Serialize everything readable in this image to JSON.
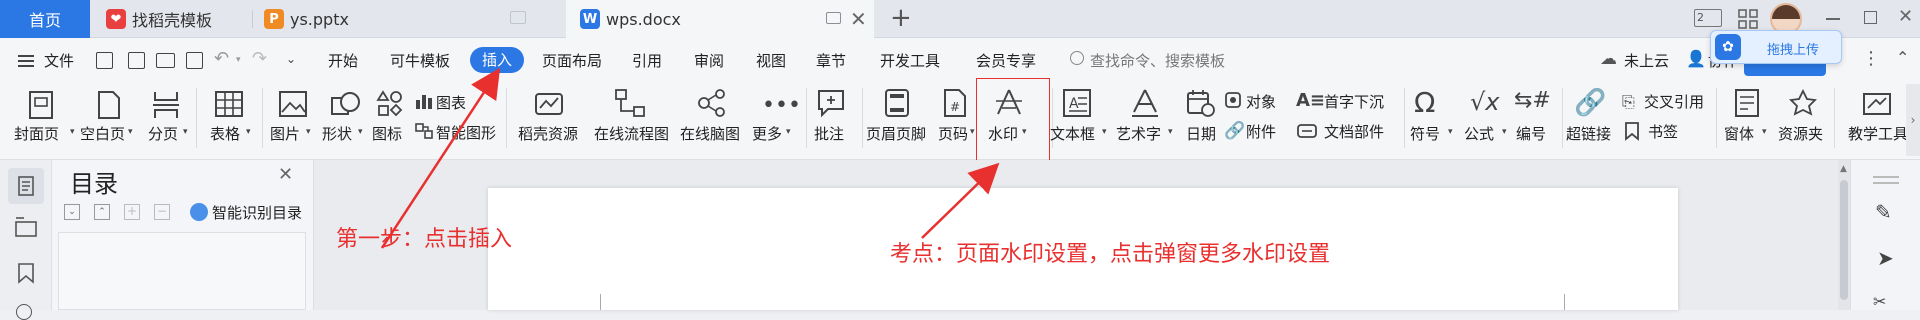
{
  "tabs": [
    {
      "label": "首页",
      "active": false,
      "home": true
    },
    {
      "label": "找稻壳模板",
      "icon": "daoke-icon"
    },
    {
      "label": "ys.pptx",
      "icon": "ppt-icon"
    },
    {
      "label": "wps.docx",
      "icon": "wps-icon",
      "active": true
    }
  ],
  "menu": {
    "file": "文件",
    "items": [
      "开始",
      "可牛模板",
      "插入",
      "页面布局",
      "引用",
      "审阅",
      "视图",
      "章节",
      "开发工具",
      "会员专享"
    ],
    "active": "插入",
    "search_placeholder": "查找命令、搜索模板",
    "cloud": "未上云",
    "collab": "协作",
    "upload": "拖拽上传"
  },
  "ribbon": {
    "cover": "封面页",
    "blank": "空白页",
    "pagebreak": "分页",
    "table": "表格",
    "picture": "图片",
    "shape": "形状",
    "iconlib": "图标",
    "chart": "图表",
    "smartart": "智能图形",
    "daoke": "稻壳资源",
    "flowchart": "在线流程图",
    "mindmap": "在线脑图",
    "more": "更多",
    "comment": "批注",
    "headerfooter": "页眉页脚",
    "pagenum": "页码",
    "watermark": "水印",
    "textbox": "文本框",
    "wordart": "艺术字",
    "date": "日期",
    "object": "对象",
    "dropcap": "首字下沉",
    "attachment": "附件",
    "docparts": "文档部件",
    "symbol": "符号",
    "formula": "公式",
    "numbering": "编号",
    "hyperlink": "超链接",
    "crossref": "交叉引用",
    "bookmark": "书签",
    "window": "窗体",
    "resource": "资源夹",
    "teaching": "教学工具"
  },
  "toc": {
    "title": "目录",
    "smart": "智能识别目录"
  },
  "annotations": {
    "step1": "第一步：点击插入",
    "point": "考点：页面水印设置，点击弹窗更多水印设置"
  },
  "colors": {
    "accent": "#2b78e4",
    "annotation": "#e8302f"
  }
}
